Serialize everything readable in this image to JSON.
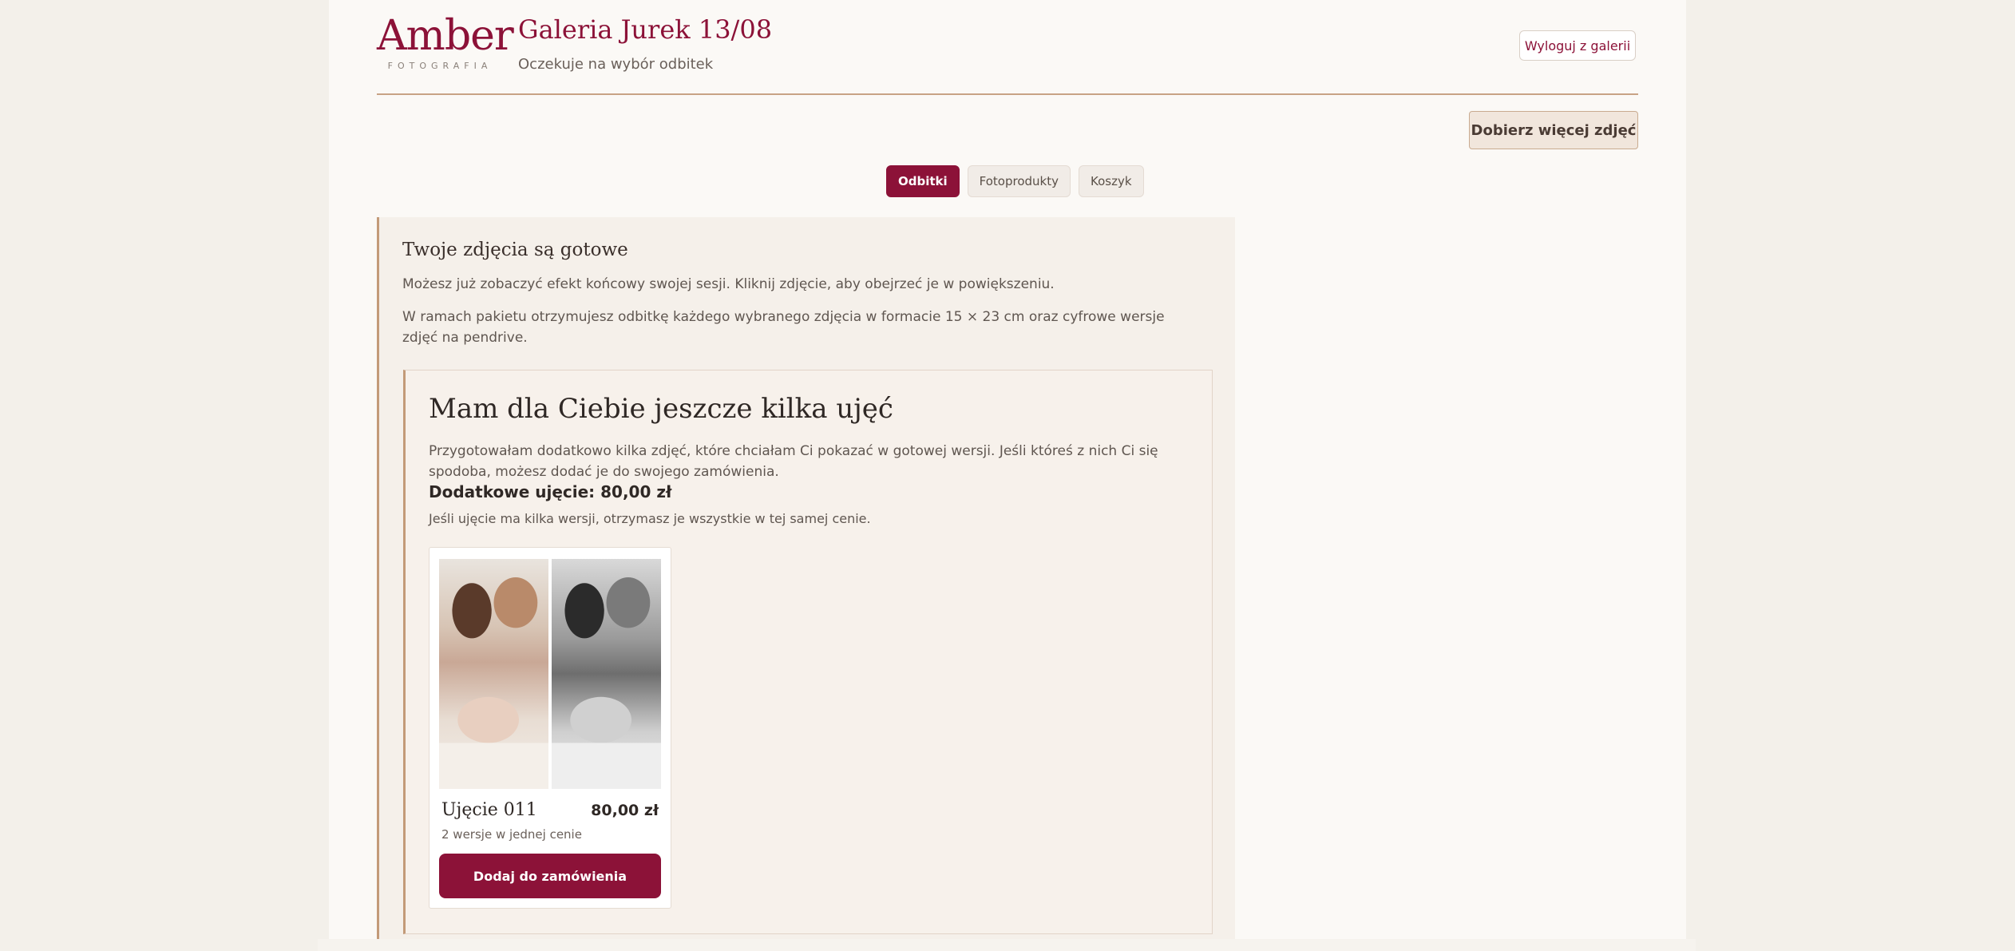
{
  "brand": {
    "name": "Amber",
    "subtitle": "FOTOGRAFIA"
  },
  "header": {
    "title": "Galeria Jurek 13/08",
    "status": "Oczekuje na wybór odbitek",
    "logout_label": "Wyloguj z galerii",
    "more_photos_label": "Dobierz więcej zdjęć"
  },
  "tabs": [
    {
      "label": "Odbitki",
      "active": true
    },
    {
      "label": "Fotoprodukty",
      "active": false
    },
    {
      "label": "Koszyk",
      "active": false
    }
  ],
  "ready": {
    "title": "Twoje zdjęcia są gotowe",
    "text1": "Możesz już zobaczyć efekt końcowy swojej sesji. Kliknij zdjęcie, aby obejrzeć je w powiększeniu.",
    "text2": "W ramach pakietu otrzymujesz odbitkę każdego wybranego zdjęcia w formacie 15 × 23 cm oraz cyfrowe wersje zdjęć na pendrive."
  },
  "extra": {
    "title": "Mam dla Ciebie jeszcze kilka ujęć",
    "text": "Przygotowałam dodatkowo kilka zdjęć, które chciałam Ci pokazać w gotowej wersji. Jeśli któreś z nich Ci się spodoba, możesz dodać je do swojego zamówienia.",
    "price_line": "Dodatkowe ujęcie: 80,00 zł",
    "note": "Jeśli ujęcie ma kilka wersji, otrzymasz je wszystkie w tej samej cenie."
  },
  "card": {
    "title": "Ujęcie 011",
    "price": "80,00 zł",
    "subtitle": "2 wersje w jednej cenie",
    "add_label": "Dodaj do zamówienia"
  },
  "colors": {
    "accent": "#8c1238",
    "panel": "#f5f0ea",
    "rule": "#c8a385"
  }
}
